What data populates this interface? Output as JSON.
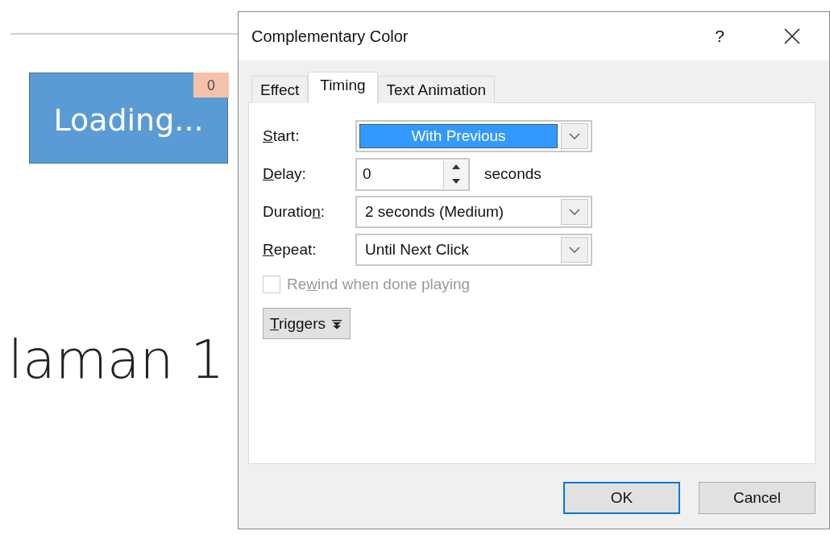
{
  "slide": {
    "shape": {
      "text": "Loading...",
      "badge": "0"
    },
    "title": "laman 1"
  },
  "dialog": {
    "title": "Complementary Color",
    "help": "?",
    "tabs": [
      {
        "label": "Effect",
        "selected": false
      },
      {
        "label": "Timing",
        "selected": true
      },
      {
        "label": "Text Animation",
        "selected": false
      }
    ],
    "fields": [
      {
        "kind": "combo",
        "label": {
          "key": "S",
          "after": "tart:"
        },
        "value": "With Previous",
        "focused": true
      },
      {
        "kind": "spin",
        "label": {
          "key": "D",
          "after": "elay:"
        },
        "value": "0",
        "unit": "seconds"
      },
      {
        "kind": "combo",
        "label": {
          "before": "Duratio",
          "key": "n",
          "after": ":"
        },
        "value": "2 seconds (Medium)",
        "focused": false
      },
      {
        "kind": "combo",
        "label": {
          "key": "R",
          "after": "epeat:"
        },
        "value": "Until Next Click",
        "focused": false
      }
    ],
    "rewind": {
      "label": {
        "before": "Re",
        "key": "w",
        "after": "ind when done playing"
      },
      "checked": false,
      "disabled": true
    },
    "triggers": {
      "label": {
        "key": "T",
        "after": "riggers"
      }
    },
    "buttons": [
      {
        "label": "OK",
        "default": true
      },
      {
        "label": "Cancel",
        "default": false
      }
    ]
  }
}
